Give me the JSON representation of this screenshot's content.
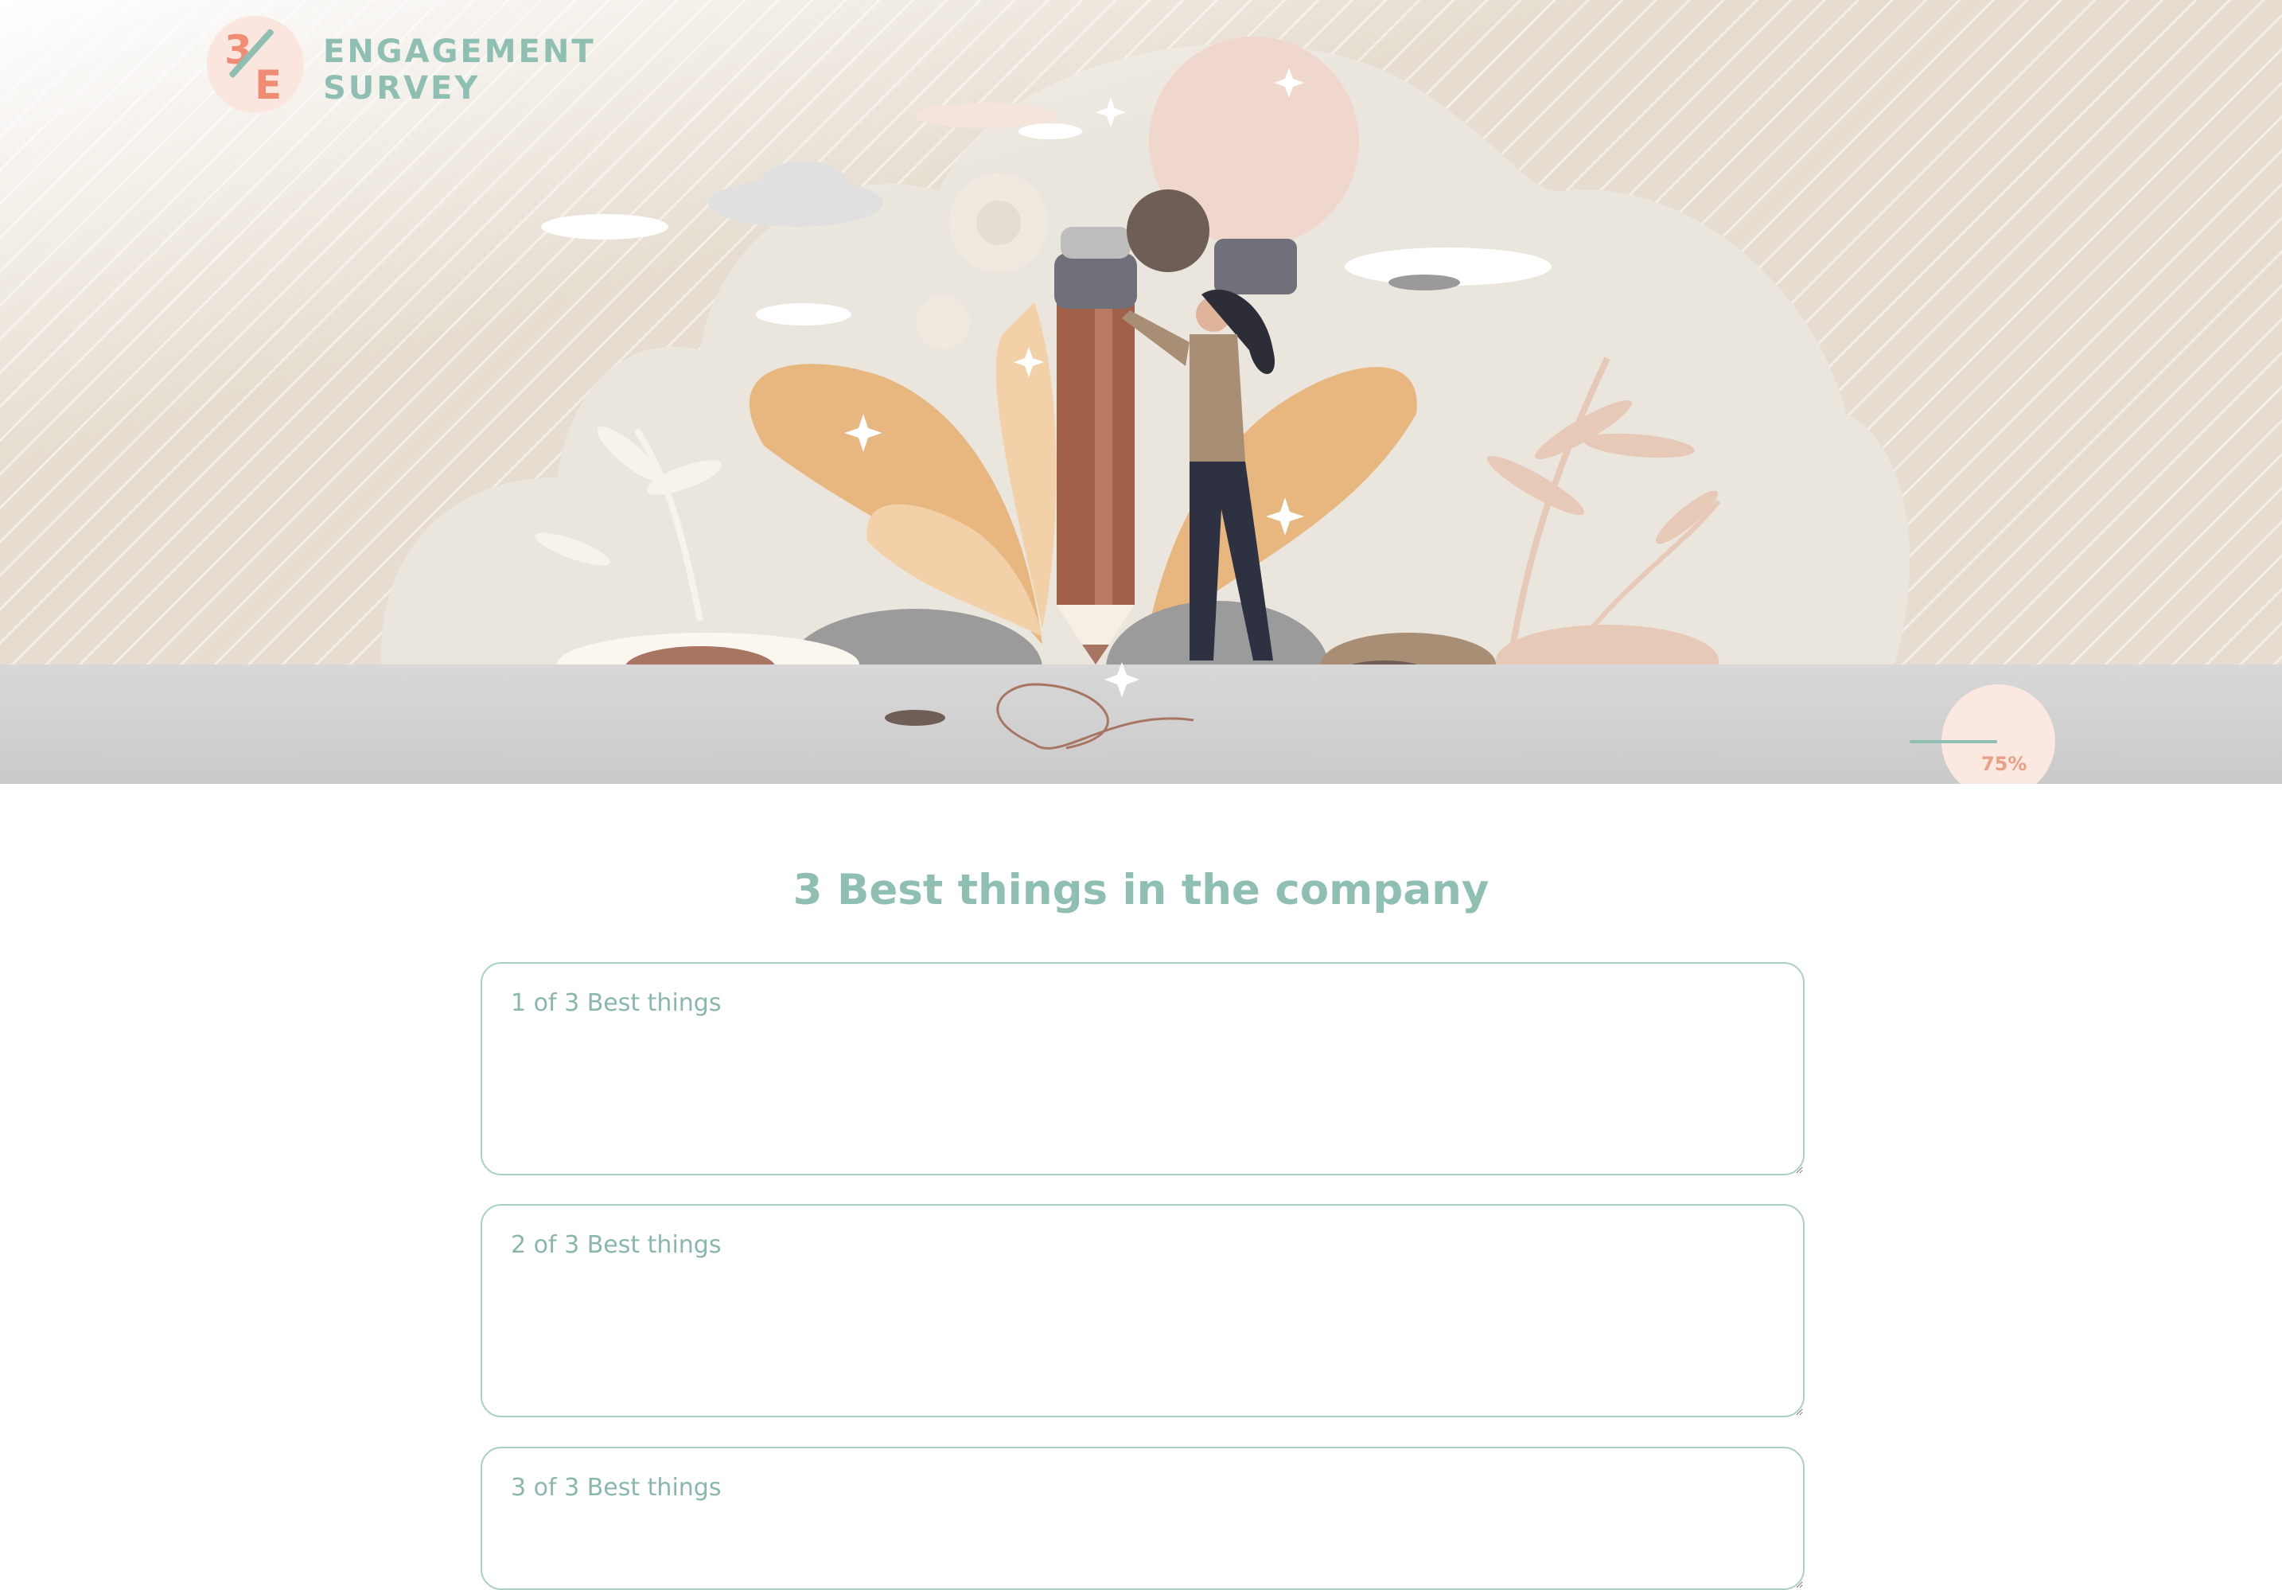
{
  "brand": {
    "logo_number": "3",
    "logo_letter": "E",
    "name_line1": "ENGAGEMENT",
    "name_line2": "SURVEY"
  },
  "progress": {
    "value_percent": 75,
    "label": "75%"
  },
  "section": {
    "title": "3 Best things in the company"
  },
  "answers": [
    {
      "placeholder": "1 of 3 Best things",
      "value": ""
    },
    {
      "placeholder": "2 of 3 Best things",
      "value": ""
    },
    {
      "placeholder": "3 of 3 Best things",
      "value": ""
    }
  ],
  "colors": {
    "accent_teal": "#8fbfb3",
    "accent_salmon": "#ef8c73",
    "hero_ground": "#cfcfcf"
  }
}
